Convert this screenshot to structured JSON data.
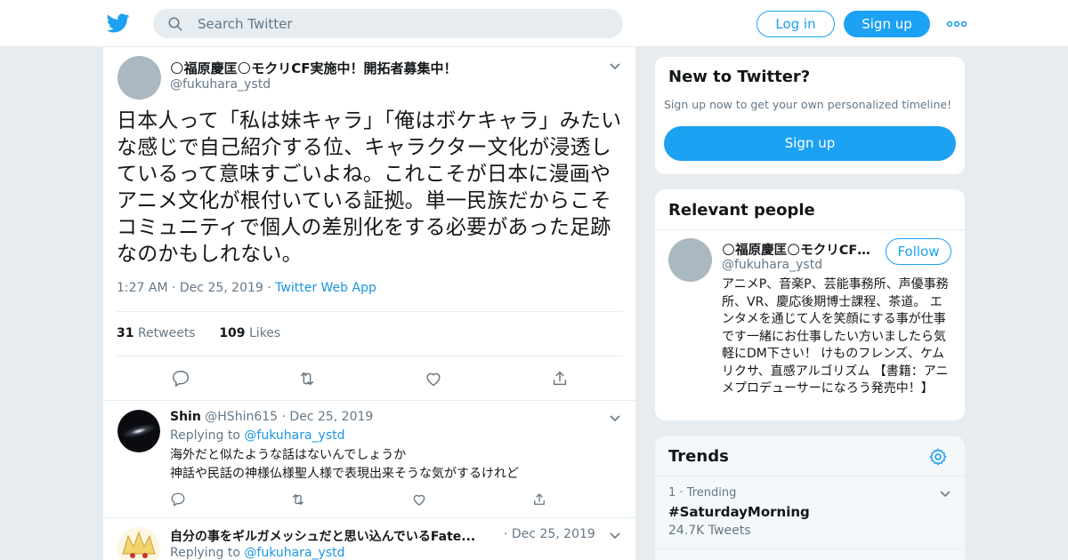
{
  "header": {
    "search_placeholder": "Search Twitter",
    "login_label": "Log in",
    "signup_label": "Sign up",
    "accent_color": "#1da1f2"
  },
  "tweet": {
    "author_name": "🌕福原慶匡🌕モクリCF実施中！開拓者募集中！",
    "author_handle": "@fukuhara_ystd",
    "text": "日本人って「私は妹キャラ」「俺はボケキャラ」みたいな感じで自己紹介する位、キャラクター文化が浸透しているって意味すごいよね。これこそが日本に漫画やアニメ文化が根付いている証拠。単一民族だからこそコミュニティで個人の差別化をする必要があった足跡なのかもしれない。",
    "time": "1:27 AM",
    "date": "Dec 25, 2019",
    "source": "Twitter Web App",
    "retweets_count": "31",
    "retweets_label": "Retweets",
    "likes_count": "109",
    "likes_label": "Likes"
  },
  "replies": [
    {
      "name": "Shin",
      "handle": "@HShin615",
      "date": "Dec 25, 2019",
      "replying_label": "Replying to",
      "replying_to": "@fukuhara_ystd",
      "line1": "海外だと似たような話はないんでしょうか",
      "line2": "神話や民話の神様仏様聖人様で表現出来そうな気がするけれど"
    },
    {
      "name": "自分の事をギルガメッシュだと思い込んでいるFate...",
      "date": "Dec 25, 2019",
      "replying_label": "Replying to",
      "replying_to": "@fukuhara_ystd"
    }
  ],
  "sidebar": {
    "new_to_twitter": {
      "title": "New to Twitter?",
      "subtitle": "Sign up now to get your own personalized timeline!",
      "button": "Sign up"
    },
    "relevant_people": {
      "title": "Relevant people",
      "name": "🌕福原慶匡🌕モクリCF実施中！開拓者募集中！",
      "handle": "@fukuhara_ystd",
      "follow_label": "Follow",
      "bio": "アニメP、音楽P、芸能事務所、声優事務所、VR、慶応後期博士課程、茶道。 エンタメを通じて人を笑顔にする事が仕事です一緒にお仕事したい方いましたら気軽にDM下さい！ けものフレンズ、ケムリクサ、直感アルゴリズム 【書籍：アニメプロデューサーになろう発売中！】"
    },
    "trends": {
      "title": "Trends",
      "items": [
        {
          "rank": "1",
          "label": "Trending",
          "tag": "#SaturdayMorning",
          "count": "24.7K Tweets"
        }
      ]
    }
  }
}
